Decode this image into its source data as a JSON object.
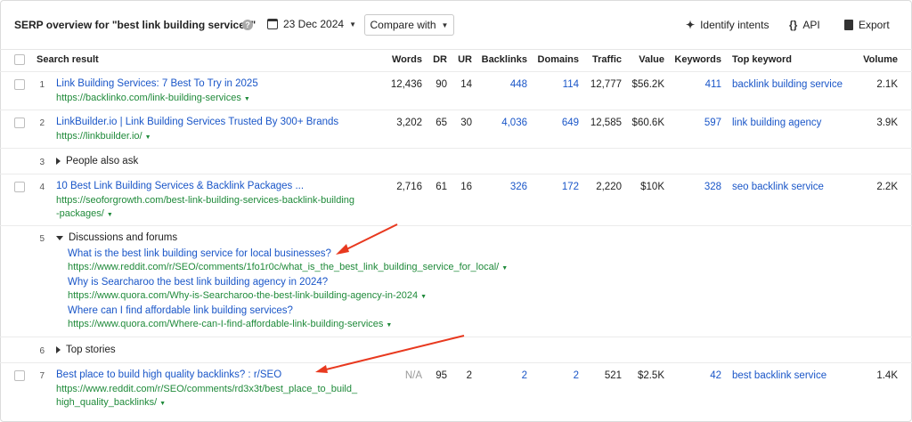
{
  "header": {
    "title": "SERP overview for \"best link building services\"",
    "help_icon": "question-circle-icon",
    "date": "23 Dec 2024",
    "compare_label": "Compare with",
    "identify_intents_label": "Identify intents",
    "api_label": "API",
    "export_label": "Export"
  },
  "columns": {
    "search_result": "Search result",
    "words": "Words",
    "dr": "DR",
    "ur": "UR",
    "backlinks": "Backlinks",
    "domains": "Domains",
    "traffic": "Traffic",
    "value": "Value",
    "keywords": "Keywords",
    "top_keyword": "Top keyword",
    "volume": "Volume"
  },
  "rows": [
    {
      "num": "1",
      "title": "Link Building Services: 7 Best To Try in 2025",
      "url": "https://backlinko.com/link-building-services",
      "words": "12,436",
      "dr": "90",
      "ur": "14",
      "backlinks": "448",
      "domains": "114",
      "traffic": "12,777",
      "value": "$56.2K",
      "keywords": "411",
      "top_keyword": "backlink building service",
      "volume": "2.1K"
    },
    {
      "num": "2",
      "title": "LinkBuilder.io | Link Building Services Trusted By 300+ Brands",
      "url": "https://linkbuilder.io/",
      "words": "3,202",
      "dr": "65",
      "ur": "30",
      "backlinks": "4,036",
      "domains": "649",
      "traffic": "12,585",
      "value": "$60.6K",
      "keywords": "597",
      "top_keyword": "link building agency",
      "volume": "3.9K"
    },
    {
      "num": "4",
      "title": "10 Best Link Building Services & Backlink Packages ...",
      "url_line1": "https://seoforgrowth.com/best-link-building-services-backlink-building",
      "url_line2": "-packages/",
      "words": "2,716",
      "dr": "61",
      "ur": "16",
      "backlinks": "326",
      "domains": "172",
      "traffic": "2,220",
      "value": "$10K",
      "keywords": "328",
      "top_keyword": "seo backlink service",
      "volume": "2.2K"
    },
    {
      "num": "7",
      "title": "Best place to build high quality backlinks? : r/SEO",
      "url_line1": "https://www.reddit.com/r/SEO/comments/rd3x3t/best_place_to_build_",
      "url_line2": "high_quality_backlinks/",
      "words": "N/A",
      "dr": "95",
      "ur": "2",
      "backlinks": "2",
      "domains": "2",
      "traffic": "521",
      "value": "$2.5K",
      "keywords": "42",
      "top_keyword": "best backlink service",
      "volume": "1.4K"
    }
  ],
  "features": {
    "people_also_ask": {
      "num": "3",
      "label": "People also ask"
    },
    "discussions": {
      "num": "5",
      "label": "Discussions and forums",
      "items": [
        {
          "title": "What is the best link building service for local businesses?",
          "url": "https://www.reddit.com/r/SEO/comments/1fo1r0c/what_is_the_best_link_building_service_for_local/"
        },
        {
          "title": "Why is Searcharoo the best link building agency in 2024?",
          "url": "https://www.quora.com/Why-is-Searcharoo-the-best-link-building-agency-in-2024"
        },
        {
          "title": "Where can I find affordable link building services?",
          "url": "https://www.quora.com/Where-can-I-find-affordable-link-building-services"
        }
      ]
    },
    "top_stories": {
      "num": "6",
      "label": "Top stories"
    }
  },
  "annotation_color": "#e8391f"
}
